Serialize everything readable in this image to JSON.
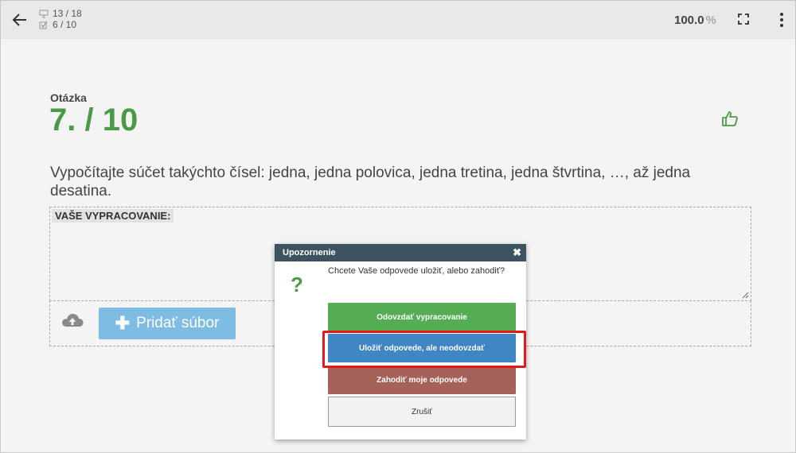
{
  "header": {
    "slides_counter": "13 / 18",
    "answered_counter": "6 / 10",
    "zoom_value": "100.0",
    "zoom_unit": "%",
    "icons": [
      "back-arrow-icon",
      "monitor-icon",
      "checkbox-icon",
      "fullscreen-icon",
      "kebab-menu-icon"
    ]
  },
  "question": {
    "label": "Otázka",
    "number": "7. / 10",
    "text": "Vypočítajte súčet takýchto čísel: jedna, jedna polovica, jedna tretina, jedna štvrtina, …, až jedna desatina.",
    "accent_color": "#4a9b48"
  },
  "answer": {
    "label": "VAŠE VYPRACOVANIE:",
    "value": ""
  },
  "upload": {
    "add_file_label": "Pridať súbor",
    "button_color": "#7fbce4"
  },
  "dialog": {
    "title": "Upozornenie",
    "close_glyph": "✖",
    "icon_glyph": "?",
    "message": "Chcete Vaše odpovede uložiť, alebo zahodiť?",
    "buttons": {
      "submit": "Odovzdať vypracovanie",
      "save": "Uložiť odpovede, ale neodovzdať",
      "discard": "Zahodiť moje odpovede",
      "cancel": "Zrušiť"
    },
    "colors": {
      "header": "#3e5361",
      "submit": "#54ad53",
      "save": "#3f86c4",
      "discard": "#a6625a",
      "highlight": "#e21a1a"
    }
  }
}
